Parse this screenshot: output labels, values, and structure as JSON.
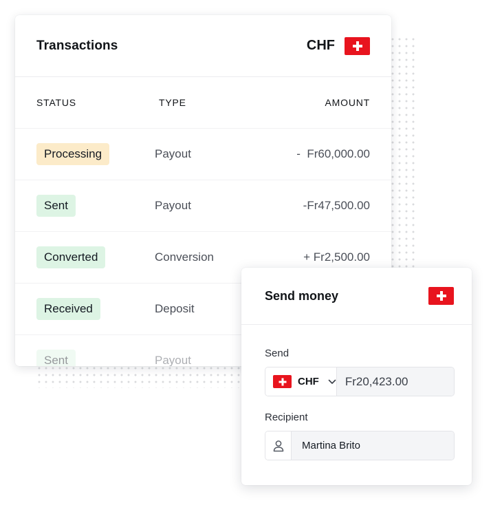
{
  "transactions": {
    "title": "Transactions",
    "currency": "CHF",
    "columns": {
      "status": "STATUS",
      "type": "TYPE",
      "amount": "AMOUNT"
    },
    "rows": [
      {
        "status": "Processing",
        "status_color": "#fcebc9",
        "type": "Payout",
        "amount": "-  Fr60,000.00"
      },
      {
        "status": "Sent",
        "status_color": "#ddf4e4",
        "type": "Payout",
        "amount": "-Fr47,500.00"
      },
      {
        "status": "Converted",
        "status_color": "#ddf4e4",
        "type": "Conversion",
        "amount": "+ Fr2,500.00"
      },
      {
        "status": "Received",
        "status_color": "#ddf4e4",
        "type": "Deposit",
        "amount": ""
      },
      {
        "status": "Sent",
        "status_color": "#ddf4e4",
        "type": "Payout",
        "amount": ""
      }
    ]
  },
  "send_money": {
    "title": "Send money",
    "send_label": "Send",
    "send_currency": "CHF",
    "send_amount": "Fr20,423.00",
    "recipient_label": "Recipient",
    "recipient_name": "Martina Brito"
  },
  "icons": {
    "flag": "swiss-flag-icon",
    "chevron": "chevron-down-icon",
    "user": "user-icon"
  },
  "colors": {
    "flag_red": "#e8141e",
    "processing_badge": "#fcebc9",
    "success_badge": "#ddf4e4"
  }
}
